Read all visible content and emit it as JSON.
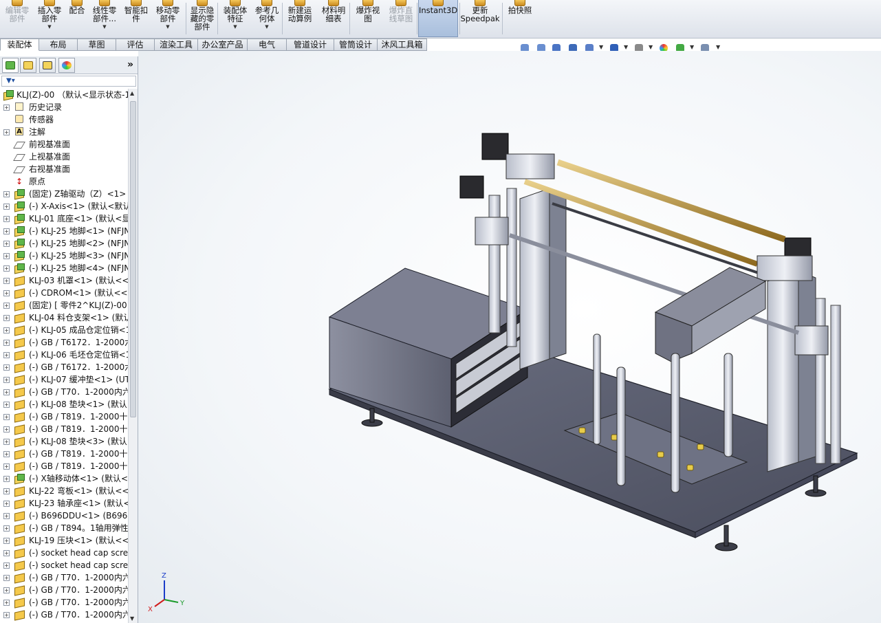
{
  "ribbon": {
    "buttons": [
      {
        "label": "编辑零\n部件",
        "disabled": true,
        "dropdown": false
      },
      {
        "label": "插入零\n部件",
        "disabled": false,
        "dropdown": true
      },
      {
        "label": "配合",
        "disabled": false,
        "dropdown": false
      },
      {
        "label": "线性零\n部件...",
        "disabled": false,
        "dropdown": true
      },
      {
        "label": "智能扣\n件",
        "disabled": false,
        "dropdown": false
      },
      {
        "label": "移动零\n部件",
        "disabled": false,
        "dropdown": true
      },
      {
        "label": "显示隐\n藏的零\n部件",
        "disabled": false,
        "dropdown": false
      },
      {
        "label": "装配体\n特征",
        "disabled": false,
        "dropdown": true
      },
      {
        "label": "参考几\n何体",
        "disabled": false,
        "dropdown": true
      },
      {
        "label": "新建运\n动算例",
        "disabled": false,
        "dropdown": false
      },
      {
        "label": "材料明\n细表",
        "disabled": false,
        "dropdown": false
      },
      {
        "label": "爆炸视\n图",
        "disabled": false,
        "dropdown": false
      },
      {
        "label": "爆炸直\n线草图",
        "disabled": true,
        "dropdown": false
      },
      {
        "label": "Instant3D",
        "disabled": false,
        "dropdown": false,
        "active": true
      },
      {
        "label": "更新\nSpeedpak",
        "disabled": false,
        "dropdown": false
      },
      {
        "label": "拍快照",
        "disabled": false,
        "dropdown": false
      }
    ]
  },
  "tabs": [
    "装配体",
    "布局",
    "草图",
    "评估",
    "渲染工具",
    "办公室产品",
    "电气",
    "管道设计",
    "管筒设计",
    "沐风工具箱"
  ],
  "active_tab": "装配体",
  "view_toolbar": {
    "icons": [
      "zoom-to-fit-icon",
      "zoom-area-icon",
      "previous-view-icon",
      "section-view-icon",
      "view-orientation-icon",
      "display-style-icon",
      "hide-show-items-icon",
      "edit-appearance-icon",
      "apply-scene-icon",
      "view-settings-icon"
    ]
  },
  "feature_manager": {
    "more": "»",
    "tree": [
      {
        "text": "KLJ(Z)-00 （默认<显示状态-1>",
        "icon": "asm",
        "root": true
      },
      {
        "text": "历史记录",
        "icon": "hist",
        "expand": true
      },
      {
        "text": "传感器",
        "icon": "sens",
        "expand": false
      },
      {
        "text": "注解",
        "icon": "note",
        "expand": true
      },
      {
        "text": "前视基准面",
        "icon": "plane",
        "expand": false
      },
      {
        "text": "上视基准面",
        "icon": "plane",
        "expand": false
      },
      {
        "text": "右视基准面",
        "icon": "plane",
        "expand": false
      },
      {
        "text": "原点",
        "icon": "origin",
        "expand": false
      },
      {
        "text": "(固定) Z轴驱动（Z）<1>（",
        "icon": "asm",
        "expand": true
      },
      {
        "text": "(-) X-Axis<1> (默认<默认",
        "icon": "asm",
        "expand": true
      },
      {
        "text": "KLJ-01 底座<1> (默认<显",
        "icon": "asm",
        "expand": true
      },
      {
        "text": "(-) KLJ-25 地脚<1> (NFJN",
        "icon": "asm",
        "expand": true
      },
      {
        "text": "(-) KLJ-25 地脚<2> (NFJN",
        "icon": "asm",
        "expand": true
      },
      {
        "text": "(-) KLJ-25 地脚<3> (NFJN",
        "icon": "asm",
        "expand": true
      },
      {
        "text": "(-) KLJ-25 地脚<4> (NFJN",
        "icon": "asm",
        "expand": true
      },
      {
        "text": "KLJ-03 机罩<1> (默认<<影",
        "icon": "part",
        "expand": true
      },
      {
        "text": "(-) CDROM<1> (默认<<默",
        "icon": "part",
        "expand": true
      },
      {
        "text": "(固定) [ 零件2^KLJ(Z)-00 ]",
        "icon": "part",
        "expand": true
      },
      {
        "text": "KLJ-04 料仓支架<1> (默认",
        "icon": "part",
        "expand": true
      },
      {
        "text": "(-) KLJ-05 成品仓定位销<1",
        "icon": "part",
        "expand": true
      },
      {
        "text": "(-) GB / T6172．1-2000六",
        "icon": "part",
        "expand": true
      },
      {
        "text": "(-) KLJ-06 毛坯仓定位销<1",
        "icon": "part",
        "expand": true
      },
      {
        "text": "(-) GB / T6172．1-2000六",
        "icon": "part",
        "expand": true
      },
      {
        "text": "(-) KLJ-07 缓冲垫<1> (UT",
        "icon": "part",
        "expand": true
      },
      {
        "text": "(-) GB / T70．1-2000内六",
        "icon": "part",
        "expand": true
      },
      {
        "text": "(-) KLJ-08 垫块<1> (默认",
        "icon": "part",
        "expand": true
      },
      {
        "text": "(-) GB / T819．1-2000十字",
        "icon": "part",
        "expand": true
      },
      {
        "text": "(-) GB / T819．1-2000十字",
        "icon": "part",
        "expand": true
      },
      {
        "text": "(-) KLJ-08 垫块<3> (默认",
        "icon": "part",
        "expand": true
      },
      {
        "text": "(-) GB / T819．1-2000十字",
        "icon": "part",
        "expand": true
      },
      {
        "text": "(-) GB / T819．1-2000十字",
        "icon": "part",
        "expand": true
      },
      {
        "text": "(-) X轴移动体<1> (默认<显",
        "icon": "asm",
        "expand": true
      },
      {
        "text": "KLJ-22 弯板<1> (默认<<影",
        "icon": "part",
        "expand": true
      },
      {
        "text": "KLJ-23 轴承座<1> (默认<",
        "icon": "part",
        "expand": true
      },
      {
        "text": "(-) B696DDU<1> (B696D",
        "icon": "part",
        "expand": true
      },
      {
        "text": "(-) GB / T894。1轴用弹性",
        "icon": "part",
        "expand": true
      },
      {
        "text": "KLJ-19 压块<1> (默认<<影",
        "icon": "part",
        "expand": true
      },
      {
        "text": "(-) socket head cap screw",
        "icon": "part",
        "expand": true
      },
      {
        "text": "(-) socket head cap screw",
        "icon": "part",
        "expand": true
      },
      {
        "text": "(-) GB / T70．1-2000内六",
        "icon": "part",
        "expand": true
      },
      {
        "text": "(-) GB / T70．1-2000内六",
        "icon": "part",
        "expand": true
      },
      {
        "text": "(-) GB / T70．1-2000内六",
        "icon": "part",
        "expand": true
      },
      {
        "text": "(-) GB / T70．1-2000内六",
        "icon": "part",
        "expand": true
      }
    ]
  },
  "triad": {
    "x": "X",
    "y": "Y",
    "z": "Z"
  },
  "colors": {
    "body": "#6b6f82",
    "rod": "#c09a3a",
    "motor": "#2a2a2e",
    "accent": "#e09a1a"
  }
}
